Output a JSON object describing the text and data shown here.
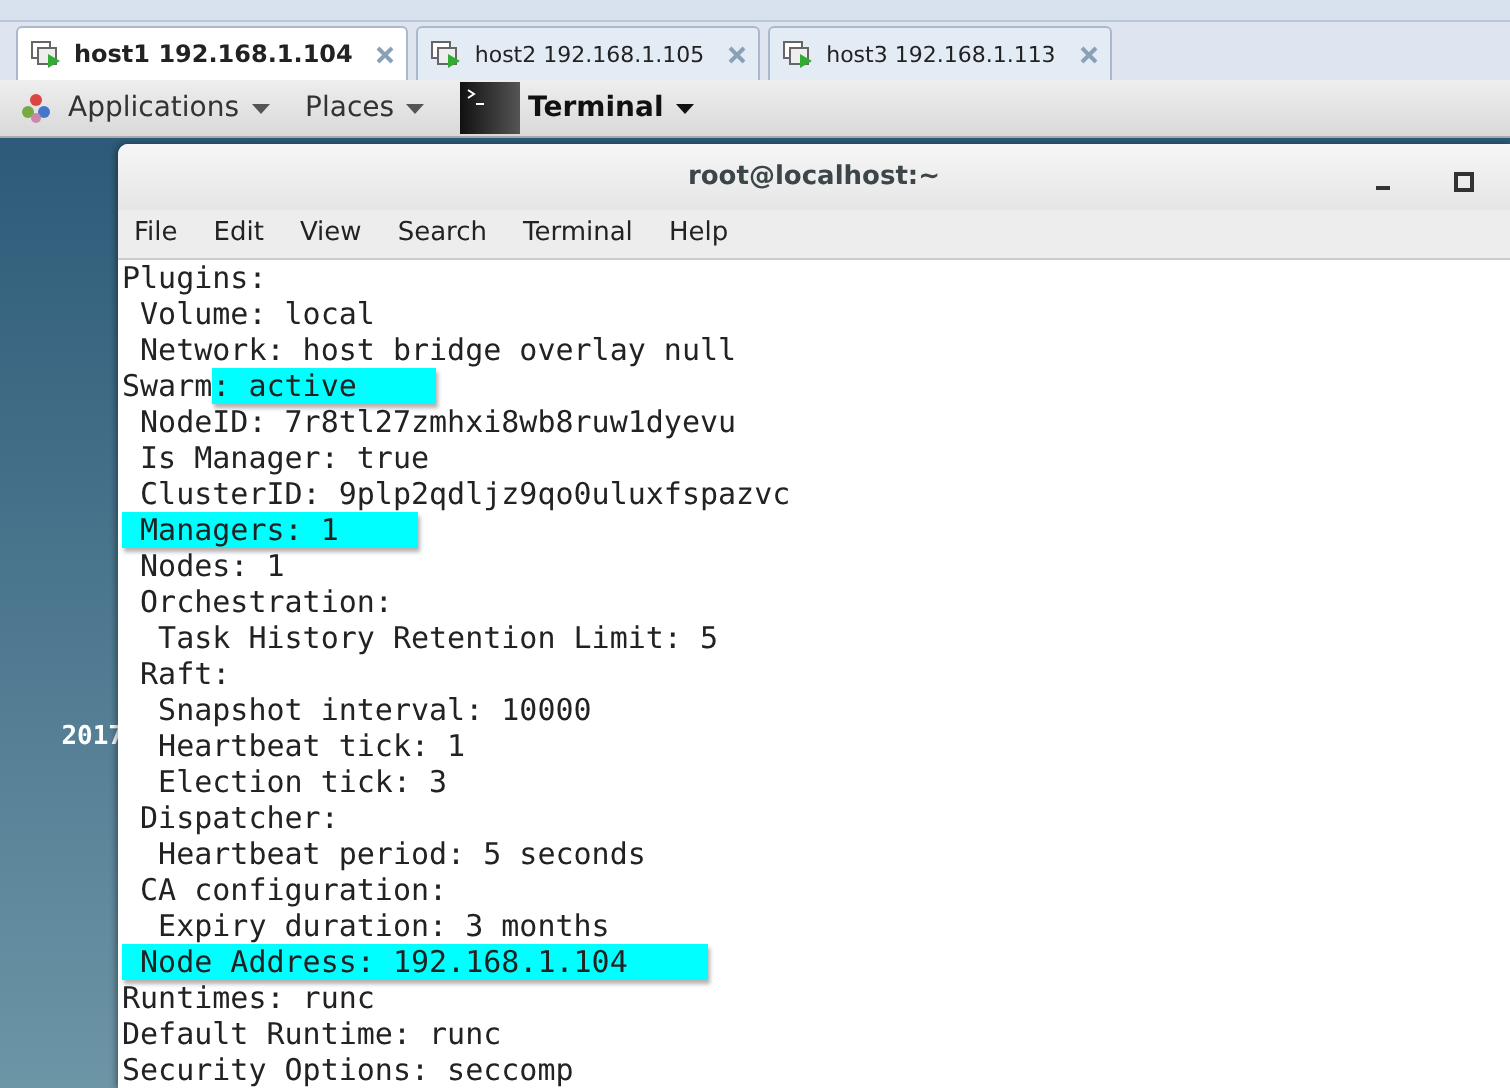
{
  "tabs": [
    {
      "label": "host1 192.168.1.104",
      "selected": true
    },
    {
      "label": "host2 192.168.1.105",
      "selected": false
    },
    {
      "label": "host3 192.168.1.113",
      "selected": false
    }
  ],
  "panel": {
    "applications": "Applications",
    "places": "Places",
    "app": "Terminal"
  },
  "desktop": {
    "label": "2017"
  },
  "window": {
    "title": "root@localhost:~",
    "menu": [
      "File",
      "Edit",
      "View",
      "Search",
      "Terminal",
      "Help"
    ]
  },
  "terminal": {
    "lines": [
      [
        {
          "text": "Plugins:",
          "highlighted": false
        }
      ],
      [
        {
          "text": " Volume: local",
          "highlighted": false
        }
      ],
      [
        {
          "text": " Network: host bridge overlay null",
          "highlighted": false
        }
      ],
      [
        {
          "text": "Swarm",
          "highlighted": false
        },
        {
          "text": ": active",
          "highlighted": true
        }
      ],
      [
        {
          "text": " NodeID: 7r8tl27zmhxi8wb8ruw1dyevu",
          "highlighted": false
        }
      ],
      [
        {
          "text": " Is Manager: true",
          "highlighted": false
        }
      ],
      [
        {
          "text": " ClusterID: 9plp2qdljz9qo0uluxfspazvc",
          "highlighted": false
        }
      ],
      [
        {
          "text": " Managers: 1",
          "highlighted": true
        }
      ],
      [
        {
          "text": " Nodes: 1",
          "highlighted": false
        }
      ],
      [
        {
          "text": " Orchestration:",
          "highlighted": false
        }
      ],
      [
        {
          "text": "  Task History Retention Limit: 5",
          "highlighted": false
        }
      ],
      [
        {
          "text": " Raft:",
          "highlighted": false
        }
      ],
      [
        {
          "text": "  Snapshot interval: 10000",
          "highlighted": false
        }
      ],
      [
        {
          "text": "  Heartbeat tick: 1",
          "highlighted": false
        }
      ],
      [
        {
          "text": "  Election tick: 3",
          "highlighted": false
        }
      ],
      [
        {
          "text": " Dispatcher:",
          "highlighted": false
        }
      ],
      [
        {
          "text": "  Heartbeat period: 5 seconds",
          "highlighted": false
        }
      ],
      [
        {
          "text": " CA configuration:",
          "highlighted": false
        }
      ],
      [
        {
          "text": "  Expiry duration: 3 months",
          "highlighted": false
        }
      ],
      [
        {
          "text": " Node Address: 192.168.1.104",
          "highlighted": true
        }
      ],
      [
        {
          "text": "Runtimes: runc",
          "highlighted": false
        }
      ],
      [
        {
          "text": "Default Runtime: runc",
          "highlighted": false
        }
      ],
      [
        {
          "text": "Security Options: seccomp",
          "highlighted": false
        }
      ]
    ]
  }
}
